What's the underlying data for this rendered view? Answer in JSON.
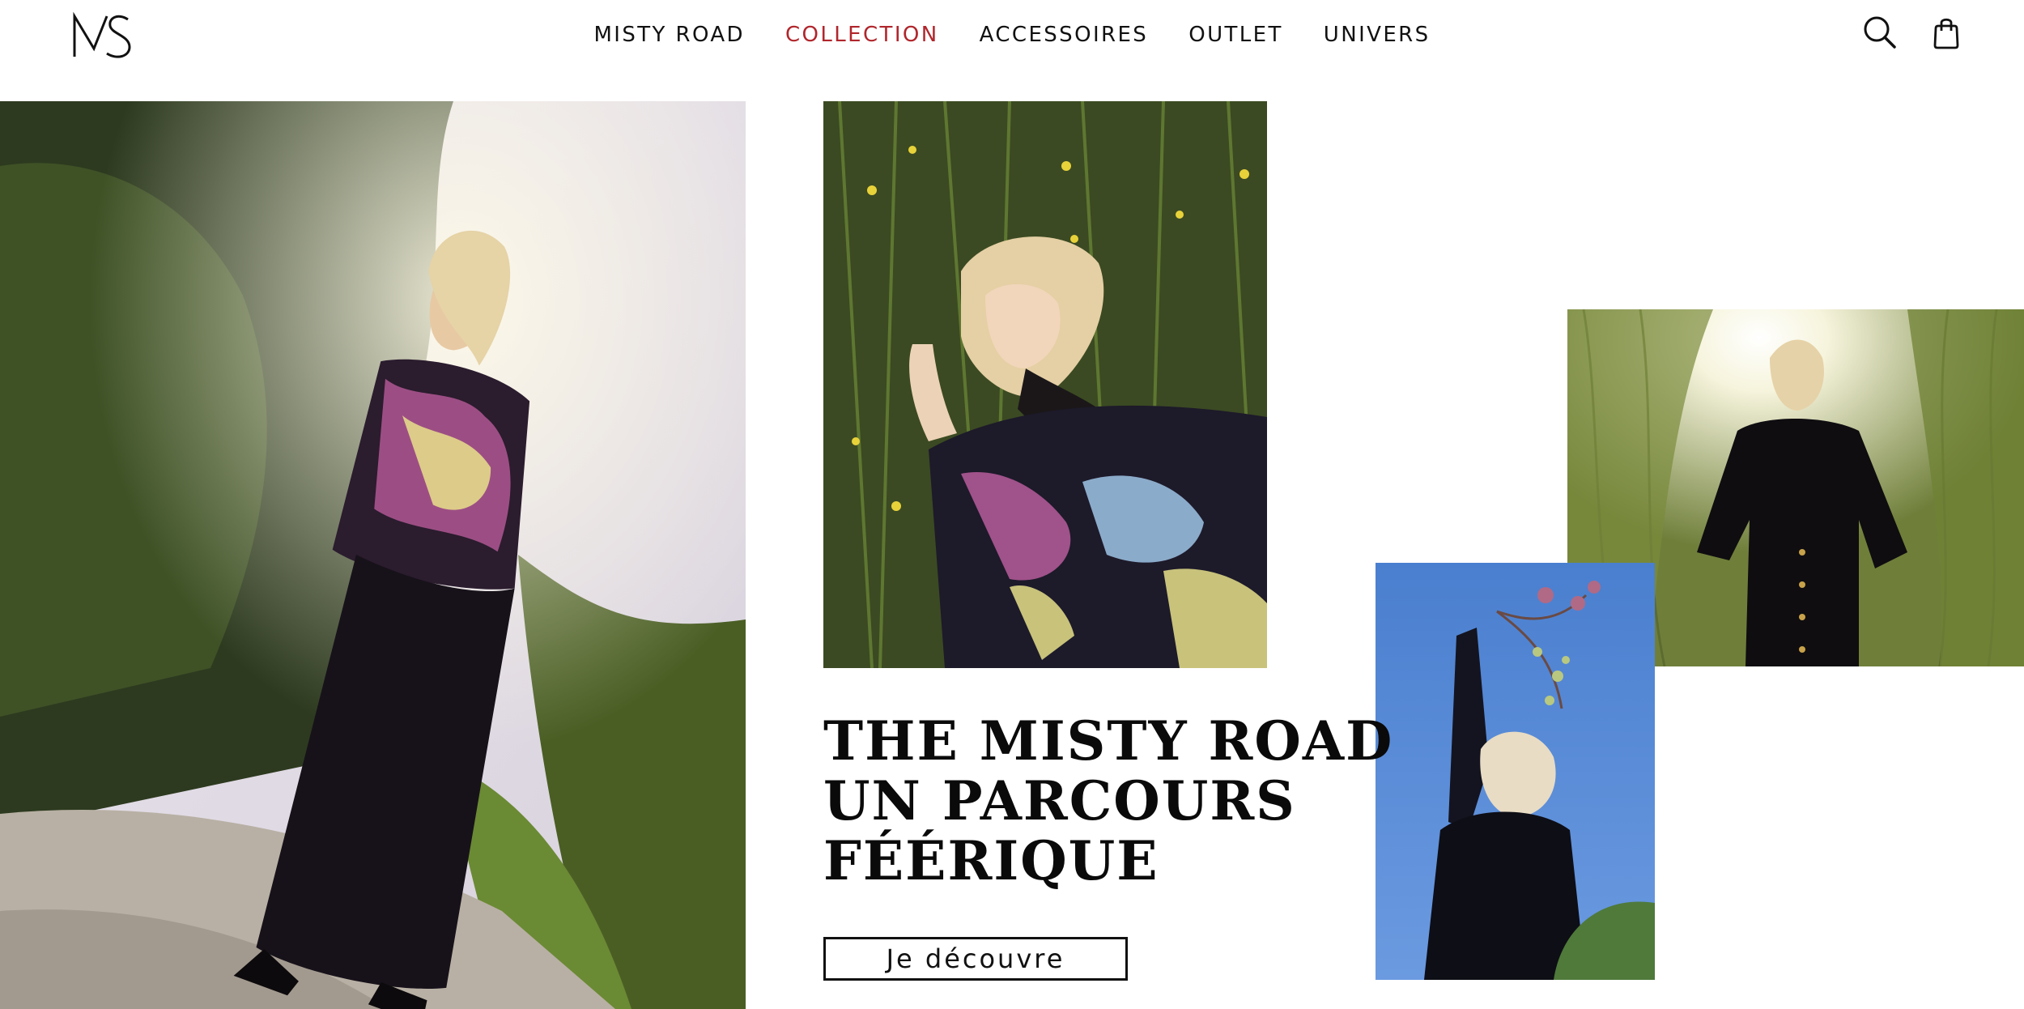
{
  "header": {
    "logo_text": "MS",
    "nav": [
      {
        "label": "MISTY ROAD",
        "active": false
      },
      {
        "label": "COLLECTION",
        "active": true
      },
      {
        "label": "ACCESSOIRES",
        "active": false
      },
      {
        "label": "OUTLET",
        "active": false
      },
      {
        "label": "UNIVERS",
        "active": false
      }
    ],
    "icons": [
      "search-icon",
      "shopping-bag-icon"
    ]
  },
  "hero": {
    "headline": [
      "THE MISTY ROAD",
      "UN PARCOURS",
      "FÉÉRIQUE"
    ],
    "cta_label": "Je découvre"
  },
  "colors": {
    "accent": "#b0262c",
    "text": "#111111",
    "background": "#ffffff"
  }
}
